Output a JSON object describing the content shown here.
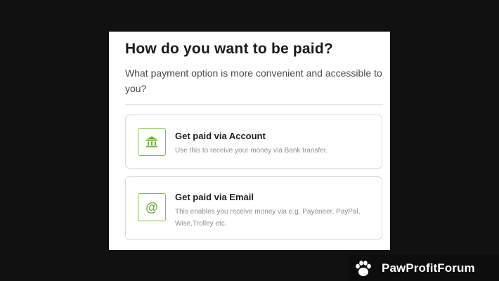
{
  "dialog": {
    "title": "How do you want to be paid?",
    "subtitle": "What payment option is more convenient and accessible to you?"
  },
  "options": [
    {
      "icon": "bank-icon",
      "title": "Get paid via Account",
      "description": "Use this to receive your money via Bank transfer."
    },
    {
      "icon": "at-sign-icon",
      "title": "Get paid via Email",
      "description": "This enables you receive money via e.g. Payoneer, PayPal, Wise,Trolley etc."
    }
  ],
  "watermark": {
    "brand": "PawProfitForum",
    "icon": "paw-icon"
  },
  "colors": {
    "accent": "#6db33f",
    "background": "#111111",
    "panel": "#ffffff"
  }
}
